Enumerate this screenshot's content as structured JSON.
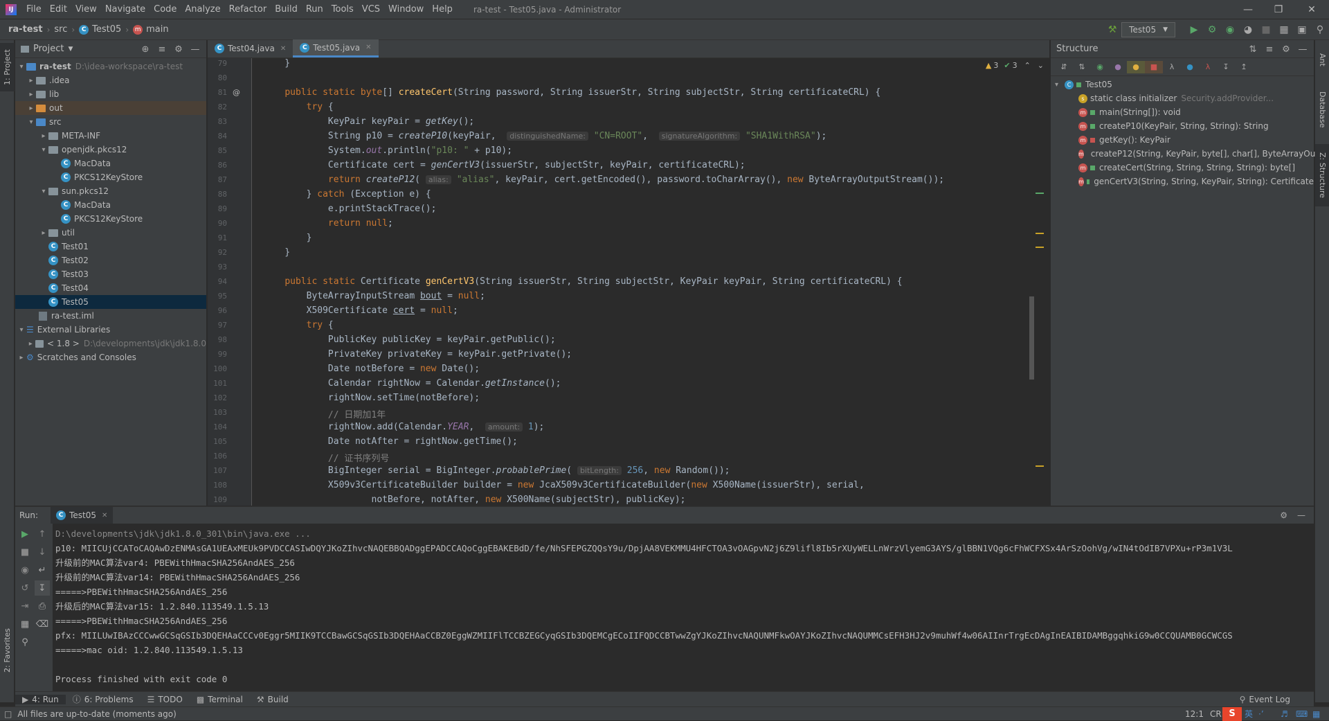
{
  "menubar": {
    "items": [
      "File",
      "Edit",
      "View",
      "Navigate",
      "Code",
      "Analyze",
      "Refactor",
      "Build",
      "Run",
      "Tools",
      "VCS",
      "Window",
      "Help"
    ],
    "title": "ra-test - Test05.java - Administrator"
  },
  "navbar": {
    "crumbs": [
      "ra-test",
      "src",
      "Test05",
      "main"
    ],
    "run_config": "Test05"
  },
  "project": {
    "title": "Project",
    "tree": [
      {
        "label": "ra-test",
        "path": "D:\\idea-workspace\\ra-test"
      },
      {
        "label": ".idea"
      },
      {
        "label": "lib"
      },
      {
        "label": "out"
      },
      {
        "label": "src"
      },
      {
        "label": "META-INF"
      },
      {
        "label": "openjdk.pkcs12"
      },
      {
        "label": "MacData"
      },
      {
        "label": "PKCS12KeyStore"
      },
      {
        "label": "sun.pkcs12"
      },
      {
        "label": "MacData"
      },
      {
        "label": "PKCS12KeyStore"
      },
      {
        "label": "util"
      },
      {
        "label": "Test01"
      },
      {
        "label": "Test02"
      },
      {
        "label": "Test03"
      },
      {
        "label": "Test04"
      },
      {
        "label": "Test05"
      },
      {
        "label": "ra-test.iml"
      },
      {
        "label": "External Libraries"
      },
      {
        "label": "< 1.8 >",
        "path": "D:\\developments\\jdk\\jdk1.8.0"
      },
      {
        "label": "Scratches and Consoles"
      }
    ]
  },
  "editor": {
    "tabs": [
      "Test04.java",
      "Test05.java"
    ],
    "warnings": "3",
    "ok": "3",
    "line_numbers": [
      "79",
      "80",
      "81",
      "82",
      "83",
      "84",
      "85",
      "86",
      "87",
      "88",
      "89",
      "90",
      "91",
      "92",
      "93",
      "94",
      "95",
      "96",
      "97",
      "98",
      "99",
      "100",
      "101",
      "102",
      "103",
      "104",
      "105",
      "106",
      "107",
      "108",
      "109"
    ]
  },
  "structure": {
    "title": "Structure",
    "root": "Test05",
    "items": [
      {
        "label": "static class initializer",
        "hint": "Security.addProvider..."
      },
      {
        "label": "main(String[]): void"
      },
      {
        "label": "createP10(KeyPair, String, String): String"
      },
      {
        "label": "getKey(): KeyPair"
      },
      {
        "label": "createP12(String, KeyPair, byte[], char[], ByteArrayOu"
      },
      {
        "label": "createCert(String, String, String, String): byte[]"
      },
      {
        "label": "genCertV3(String, String, KeyPair, String): Certificate"
      }
    ]
  },
  "run": {
    "label": "Run:",
    "tab": "Test05",
    "lines": [
      "D:\\developments\\jdk\\jdk1.8.0_301\\bin\\java.exe ...",
      "p10: MIICUjCCAToCAQAwDzENMAsGA1UEAxMEUk9PVDCCASIwDQYJKoZIhvcNAQEBBQADggEPADCCAQoCggEBAKEBdD/fe/NhSFEPGZQQsY9u/DpjAA8VEKMMU4HFCTOA3vOAGpvN2j6Z9lifl8Ib5rXUyWELLnWrzVlyemG3AYS/glBBN1VQg6cFhWCFXSx4ArSzOohVg/wIN4tOdIB7VPXu+rP3m1V3L",
      "升级前的MAC算法var4: PBEWithHmacSHA256AndAES_256",
      "升级前的MAC算法var14: PBEWithHmacSHA256AndAES_256",
      "=====>PBEWithHmacSHA256AndAES_256",
      "升级后的MAC算法var15: 1.2.840.113549.1.5.13",
      "=====>PBEWithHmacSHA256AndAES_256",
      "pfx: MIILUwIBAzCCCwwGCSqGSIb3DQEHAaCCCv0Eggr5MIIK9TCCBawGCSqGSIb3DQEHAaCCBZ0EggWZMIIFlTCCBZEGCyqGSIb3DQEMCgECoIIFQDCCBTwwZgYJKoZIhvcNAQUNMFkwOAYJKoZIhvcNAQUMMCsEFH3HJ2v9muhWf4w06AIInrTrgEcDAgInEAIBIDAMBggqhkiG9w0CCQUAMB0GCWCGS",
      "=====>mac oid: 1.2.840.113549.1.5.13",
      "",
      "Process finished with exit code 0"
    ]
  },
  "bottom_tabs": [
    "4: Run",
    "6: Problems",
    "TODO",
    "Terminal",
    "Build"
  ],
  "event_log": "Event Log",
  "status": {
    "message": "All files are up-to-date (moments ago)",
    "position": "12:1",
    "line_sep": "CRL",
    "ime": "英"
  },
  "side_tabs": {
    "left": [
      "1: Project",
      "2: Favorites"
    ],
    "right": [
      "Ant",
      "Database",
      "Z: Structure"
    ]
  }
}
